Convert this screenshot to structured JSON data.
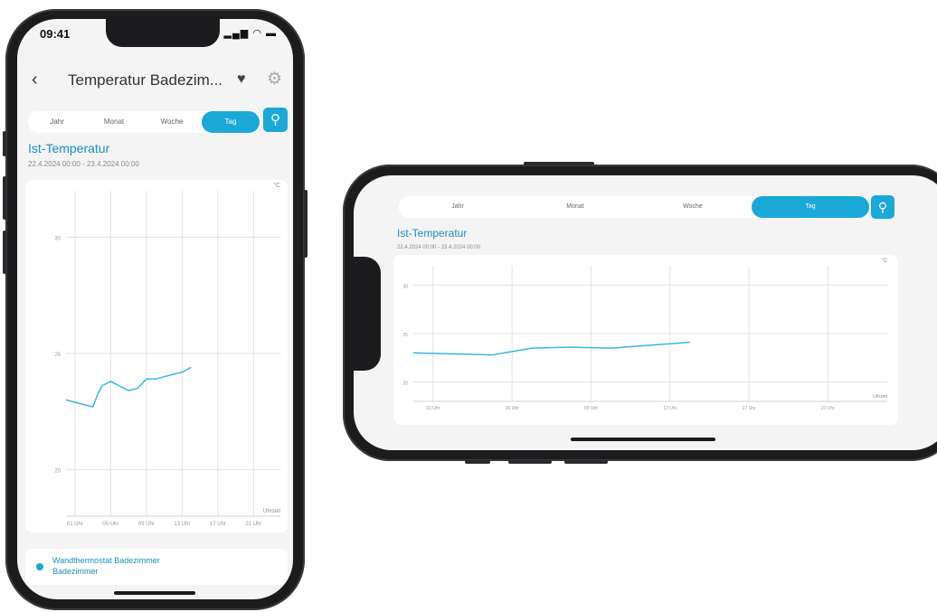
{
  "portrait": {
    "status_time": "09:41",
    "title": "Temperatur Badezim...",
    "tabs": [
      "Jahr",
      "Monat",
      "Woche",
      "Tag"
    ],
    "active_tab": "Tag",
    "section_title": "Ist-Temperatur",
    "date_range": "22.4.2024 00:00 - 23.4.2024 00:00",
    "unit": "°C",
    "x_axis_title": "Uhrzeit",
    "legend": {
      "device": "Wandthermostat Badezimmer",
      "room": "Badezimmer"
    }
  },
  "landscape": {
    "tabs": [
      "Jahr",
      "Monat",
      "Woche",
      "Tag"
    ],
    "active_tab": "Tag",
    "section_title": "Ist-Temperatur",
    "date_range": "22.4.2024 00:00 - 23.4.2024 00:00",
    "unit": "°C",
    "x_axis_title": "Uhrzeit"
  },
  "colors": {
    "accent": "#1aa8d8",
    "line": "#3bb7e0"
  },
  "chart_data": [
    {
      "type": "line",
      "title": "Ist-Temperatur",
      "xlabel": "Uhrzeit",
      "ylabel": "°C",
      "y_ticks": [
        20,
        25,
        30
      ],
      "ylim": [
        18,
        32
      ],
      "x_ticks": [
        "01 Uhr",
        "05 Uhr",
        "09 Uhr",
        "13 Uhr",
        "17 Uhr",
        "21 Uhr"
      ],
      "xlim": [
        0,
        24
      ],
      "grid": true,
      "series": [
        {
          "x": [
            0,
            1,
            2,
            3,
            3.5,
            4,
            5,
            6,
            7,
            8,
            9,
            10,
            11,
            12,
            13,
            14
          ],
          "y": [
            23.0,
            22.9,
            22.8,
            22.7,
            23.2,
            23.6,
            23.8,
            23.6,
            23.4,
            23.5,
            23.9,
            23.9,
            24.0,
            24.1,
            24.2,
            24.4
          ]
        }
      ]
    },
    {
      "type": "line",
      "title": "Ist-Temperatur",
      "xlabel": "Uhrzeit",
      "ylabel": "°C",
      "y_ticks": [
        20,
        25,
        30
      ],
      "ylim": [
        18,
        32
      ],
      "x_ticks": [
        "01 Uhr",
        "05 Uhr",
        "09 Uhr",
        "13 Uhr",
        "17 Uhr",
        "21 Uhr"
      ],
      "xlim": [
        0,
        24
      ],
      "grid": true,
      "series": [
        {
          "x": [
            0,
            2,
            4,
            6,
            8,
            10,
            12,
            14
          ],
          "y": [
            23.0,
            22.9,
            22.8,
            23.5,
            23.6,
            23.5,
            23.8,
            24.1
          ]
        }
      ]
    }
  ]
}
